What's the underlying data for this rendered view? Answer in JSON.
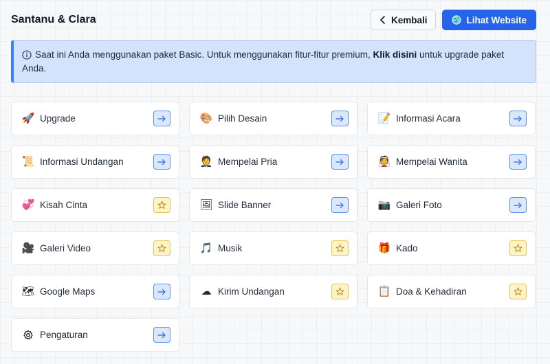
{
  "header": {
    "title": "Santanu & Clara",
    "back_label": "Kembali",
    "website_label": "Lihat Website"
  },
  "notice": {
    "text_before": "Saat ini Anda menggunakan paket Basic. Untuk menggunakan fitur-fitur premium, ",
    "link_text": "Klik disini",
    "text_after": " untuk upgrade paket Anda."
  },
  "menu": {
    "items": [
      {
        "label": "Upgrade",
        "icon": "rocket-icon",
        "badge": "arrow"
      },
      {
        "label": "Pilih Desain",
        "icon": "palette-icon",
        "badge": "arrow"
      },
      {
        "label": "Informasi Acara",
        "icon": "memo-icon",
        "badge": "arrow"
      },
      {
        "label": "Informasi Undangan",
        "icon": "scroll-icon",
        "badge": "arrow"
      },
      {
        "label": "Mempelai Pria",
        "icon": "groom-icon",
        "badge": "arrow"
      },
      {
        "label": "Mempelai Wanita",
        "icon": "bride-icon",
        "badge": "arrow"
      },
      {
        "label": "Kisah Cinta",
        "icon": "heart-icon",
        "badge": "star"
      },
      {
        "label": "Slide Banner",
        "icon": "framed-picture-icon",
        "badge": "arrow"
      },
      {
        "label": "Galeri Foto",
        "icon": "camera-icon",
        "badge": "arrow"
      },
      {
        "label": "Galeri Video",
        "icon": "video-camera-icon",
        "badge": "star"
      },
      {
        "label": "Musik",
        "icon": "music-note-icon",
        "badge": "star"
      },
      {
        "label": "Kado",
        "icon": "gift-icon",
        "badge": "star"
      },
      {
        "label": "Google Maps",
        "icon": "map-icon",
        "badge": "arrow"
      },
      {
        "label": "Kirim Undangan",
        "icon": "cloud-icon",
        "badge": "star"
      },
      {
        "label": "Doa & Kehadiran",
        "icon": "clipboard-icon",
        "badge": "star"
      },
      {
        "label": "Pengaturan",
        "icon": "gear-icon",
        "badge": "arrow"
      }
    ]
  },
  "colors": {
    "primary": "#2563eb",
    "notice_bg": "#d3e3fb",
    "arrow_badge_bg": "#dbe7fb",
    "star_badge_bg": "#fdf3c8"
  }
}
